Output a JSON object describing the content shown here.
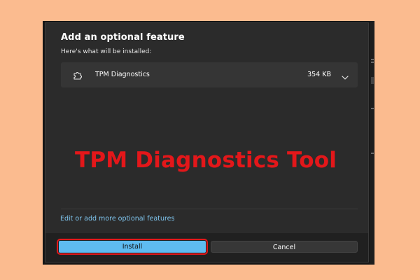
{
  "dialog": {
    "title": "Add an optional feature",
    "subtitle": "Here's what will be installed:"
  },
  "feature": {
    "icon": "puzzle-piece-icon",
    "name": "TPM Diagnostics",
    "size": "354 KB",
    "expand_icon": "chevron-down-icon"
  },
  "overlay": {
    "caption": "TPM Diagnostics Tool"
  },
  "more_link": {
    "label": "Edit or add more optional features"
  },
  "buttons": {
    "install": "Install",
    "cancel": "Cancel"
  },
  "colors": {
    "page_background": "#fbbb8f",
    "dialog_background": "#2b2b2b",
    "feature_row_background": "#353535",
    "footer_background": "#202020",
    "accent": "#5ebbf0",
    "link": "#7fc5ee",
    "caption_red": "#e3171a"
  }
}
